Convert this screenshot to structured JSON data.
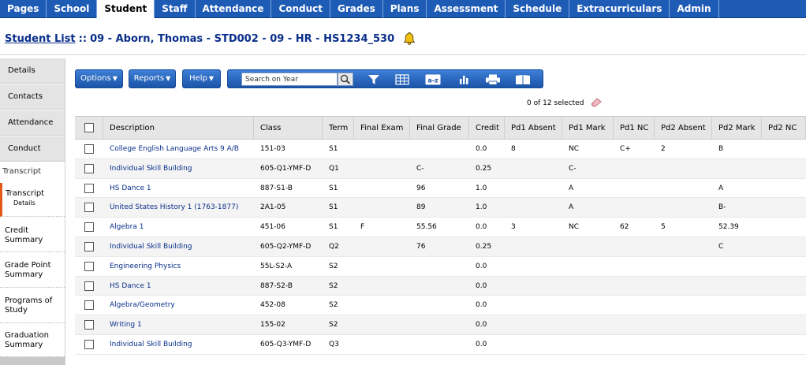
{
  "nav": {
    "tabs": [
      "Pages",
      "School",
      "Student",
      "Staff",
      "Attendance",
      "Conduct",
      "Grades",
      "Plans",
      "Assessment",
      "Schedule",
      "Extracurriculars",
      "Admin"
    ],
    "active": "Student"
  },
  "header": {
    "breadcrumb": "Student List",
    "separator": "::",
    "student": "09 - Aborn, Thomas - STD002 - 09 - HR - HS1234_530",
    "bell_icon": "bell-icon"
  },
  "sidebar": {
    "items": [
      "Details",
      "Contacts",
      "Attendance",
      "Conduct"
    ],
    "section": "Transcript",
    "sub_items": [
      {
        "label": "Transcript",
        "sub": "Details"
      },
      {
        "label": "Credit Summary",
        "sub": ""
      },
      {
        "label": "Grade Point Summary",
        "sub": ""
      },
      {
        "label": "Programs of Study",
        "sub": ""
      },
      {
        "label": "Graduation Summary",
        "sub": ""
      }
    ]
  },
  "toolbar": {
    "options_label": "Options",
    "reports_label": "Reports",
    "help_label": "Help",
    "search_placeholder": "Search on Year",
    "icons": [
      "magnifier-icon",
      "filter-icon",
      "grid-icon",
      "sort-az-icon",
      "chart-icon",
      "print-icon",
      "book-icon"
    ]
  },
  "selection": {
    "text": "0 of 12 selected"
  },
  "table": {
    "columns": [
      "Description",
      "Class",
      "Term",
      "Final Exam",
      "Final Grade",
      "Credit",
      "Pd1 Absent",
      "Pd1 Mark",
      "Pd1 NC",
      "Pd2 Absent",
      "Pd2 Mark",
      "Pd2 NC"
    ],
    "rows": [
      [
        "College English Language Arts 9 A/B",
        "151-03",
        "S1",
        "",
        "",
        "0.0",
        "8",
        "NC",
        "C+",
        "2",
        "B",
        ""
      ],
      [
        "Individual Skill Building",
        "605-Q1-YMF-D",
        "Q1",
        "",
        "C-",
        "0.25",
        "",
        "C-",
        "",
        "",
        "",
        ""
      ],
      [
        "HS Dance 1",
        "887-S1-B",
        "S1",
        "",
        "96",
        "1.0",
        "",
        "A",
        "",
        "",
        "A",
        ""
      ],
      [
        "United States History 1 (1763-1877)",
        "2A1-05",
        "S1",
        "",
        "89",
        "1.0",
        "",
        "A",
        "",
        "",
        "B-",
        ""
      ],
      [
        "Algebra 1",
        "451-06",
        "S1",
        "F",
        "55.56",
        "0.0",
        "3",
        "NC",
        "62",
        "5",
        "52.39",
        ""
      ],
      [
        "Individual Skill Building",
        "605-Q2-YMF-D",
        "Q2",
        "",
        "76",
        "0.25",
        "",
        "",
        "",
        "",
        "C",
        ""
      ],
      [
        "Engineering Physics",
        "55L-S2-A",
        "S2",
        "",
        "",
        "0.0",
        "",
        "",
        "",
        "",
        "",
        ""
      ],
      [
        "HS Dance 1",
        "887-S2-B",
        "S2",
        "",
        "",
        "0.0",
        "",
        "",
        "",
        "",
        "",
        ""
      ],
      [
        "Algebra/Geometry",
        "452-08",
        "S2",
        "",
        "",
        "0.0",
        "",
        "",
        "",
        "",
        "",
        ""
      ],
      [
        "Writing 1",
        "155-02",
        "S2",
        "",
        "",
        "0.0",
        "",
        "",
        "",
        "",
        "",
        ""
      ],
      [
        "Individual Skill Building",
        "605-Q3-YMF-D",
        "Q3",
        "",
        "",
        "0.0",
        "",
        "",
        "",
        "",
        "",
        ""
      ]
    ]
  },
  "colors": {
    "nav_bg": "#1e5bb5",
    "title": "#0a2f8a",
    "link": "#0a2f8a",
    "active_marker": "#e05a1a"
  }
}
